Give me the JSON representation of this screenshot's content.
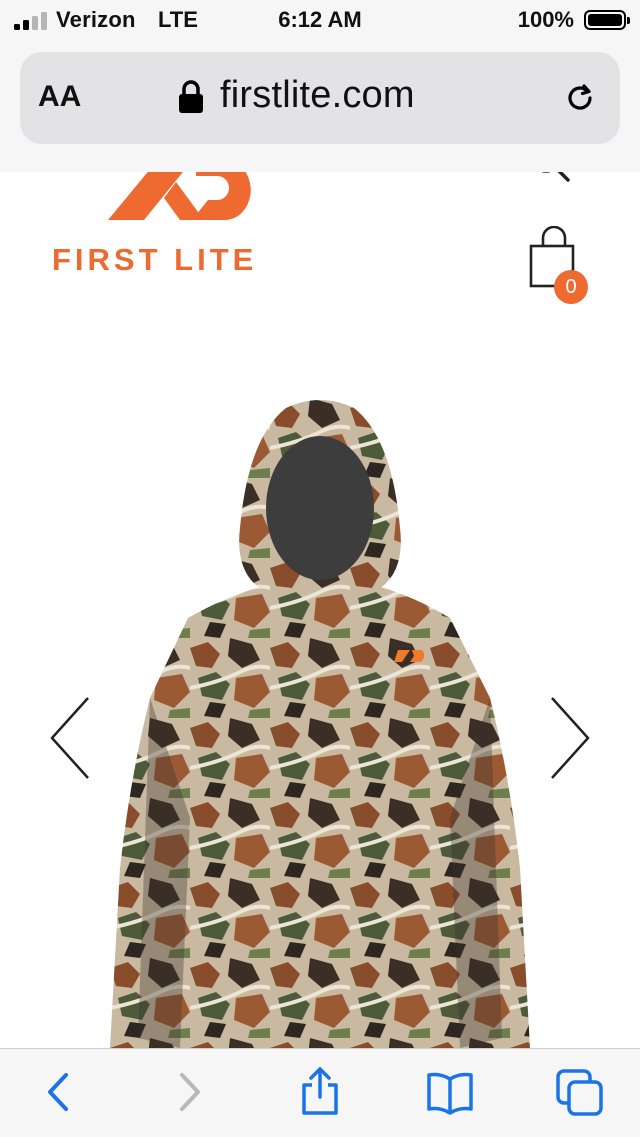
{
  "status_bar": {
    "carrier": "Verizon",
    "network": "LTE",
    "time": "6:12 AM",
    "battery": "100%",
    "battery_level": 1.0
  },
  "browser": {
    "text_size_label": "AA",
    "url": "firstlite.com",
    "icons": [
      "lock-icon",
      "reload-icon"
    ]
  },
  "header": {
    "brand_name": "FIRST LITE",
    "icons": [
      "menu-icon",
      "search-icon",
      "shopping-bag-icon"
    ],
    "cart_count": "0",
    "accent_color": "#ee6a31"
  },
  "carousel": {
    "image_alt": "Camouflage hooded base layer top",
    "icons": [
      "chevron-left-icon",
      "chevron-right-icon"
    ]
  },
  "toolbar": {
    "icons": [
      "back-icon",
      "forward-icon",
      "share-icon",
      "bookmarks-icon",
      "tabs-icon"
    ],
    "accent_color": "#1a73e8"
  }
}
